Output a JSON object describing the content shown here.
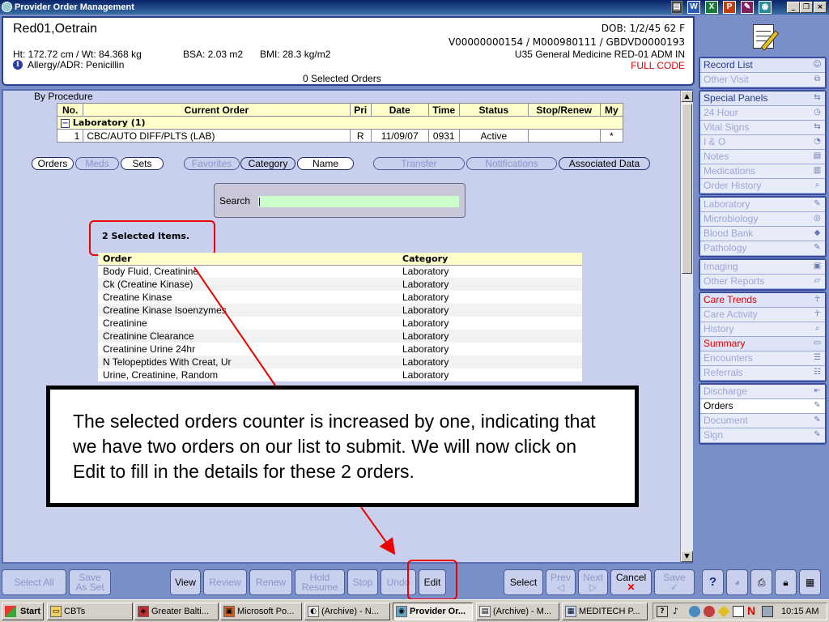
{
  "window": {
    "title": "Provider Order Management"
  },
  "patient": {
    "name": "Red01,Oetrain",
    "dob": "DOB: 1/2/45 62 F",
    "ids": "V00000000154 / M000980111 / GBDVD0000193",
    "location": "U35 General Medicine RED-01  ADM IN",
    "code_status": "FULL CODE",
    "ht_wt": "Ht: 172.72 cm / Wt: 84.368 kg",
    "bsa": "BSA: 2.03 m2",
    "bmi": "BMI: 28.3 kg/m2",
    "allergy": "Allergy/ADR: Penicillin",
    "selected_orders": "0 Selected Orders"
  },
  "orders": {
    "group_label": "By Procedure",
    "columns": [
      "No.",
      "Current Order",
      "Pri",
      "Date",
      "Time",
      "Status",
      "Stop/Renew",
      "My"
    ],
    "section": "Laboratory   (1)",
    "row": {
      "no": "1",
      "order": "CBC/AUTO DIFF/PLTS (LAB)",
      "pri": "R",
      "date": "11/09/07",
      "time": "0931",
      "status": "Active",
      "stop": "",
      "my": "*"
    }
  },
  "tabs": {
    "orders": "Orders",
    "meds": "Meds",
    "sets": "Sets",
    "favorites": "Favorites",
    "category": "Category",
    "name": "Name",
    "transfer": "Transfer",
    "notifications": "Notifications",
    "associated": "Associated Data"
  },
  "search": {
    "label": "Search",
    "value": "|"
  },
  "selection": {
    "count_label": "2 Selected Items."
  },
  "results": {
    "columns": [
      "Order",
      "Category"
    ],
    "rows": [
      [
        "Body Fluid, Creatinine",
        "Laboratory"
      ],
      [
        "Ck (Creatine Kinase)",
        "Laboratory"
      ],
      [
        "Creatine Kinase",
        "Laboratory"
      ],
      [
        "Creatine Kinase Isoenzymes",
        "Laboratory"
      ],
      [
        "Creatinine",
        "Laboratory"
      ],
      [
        "Creatinine Clearance",
        "Laboratory"
      ],
      [
        "Creatinine Urine 24hr",
        "Laboratory"
      ],
      [
        "N Telopeptides With Creat, Ur",
        "Laboratory"
      ],
      [
        "Urine, Creatinine, Random",
        "Laboratory"
      ]
    ]
  },
  "callout": {
    "text": "The selected orders counter is increased by one, indicating that we have two orders on our list to submit. We will now click on Edit to fill in the details for these 2 orders."
  },
  "sidebar": {
    "g1": [
      "Record List",
      "Other Visit"
    ],
    "g2": [
      "Special Panels",
      "24 Hour",
      "Vital Signs",
      "I & O",
      "Notes",
      "Medications",
      "Order History"
    ],
    "g3": [
      "Laboratory",
      "Microbiology",
      "Blood Bank",
      "Pathology"
    ],
    "g4": [
      "Imaging",
      "Other Reports"
    ],
    "g5": [
      "Care Trends",
      "Care Activity",
      "History",
      "Summary",
      "Encounters",
      "Referrals"
    ],
    "g6": [
      "Discharge",
      "Orders",
      "Document",
      "Sign"
    ]
  },
  "bottom": {
    "select_all": "Select All",
    "save_as_set_1": "Save",
    "save_as_set_2": "As Set",
    "view": "View",
    "review": "Review",
    "renew": "Renew",
    "hold_1": "Hold",
    "hold_2": "Resume",
    "stop": "Stop",
    "undo": "Undo",
    "edit": "Edit",
    "select": "Select",
    "prev": "Prev",
    "next": "Next",
    "cancel": "Cancel",
    "save": "Save",
    "help": "?"
  },
  "taskbar": {
    "start": "Start",
    "items": [
      "CBTs",
      "Greater Balti...",
      "Microsoft Po...",
      "(Archive) - N...",
      "Provider Or...",
      "(Archive) - M...",
      "MEDITECH P..."
    ],
    "clock": "10:15 AM"
  },
  "colors": {
    "accent": "#2a3d8f",
    "highlight_red": "#e00000",
    "search_bg": "#ccffcc",
    "table_header": "#ffffcc"
  }
}
